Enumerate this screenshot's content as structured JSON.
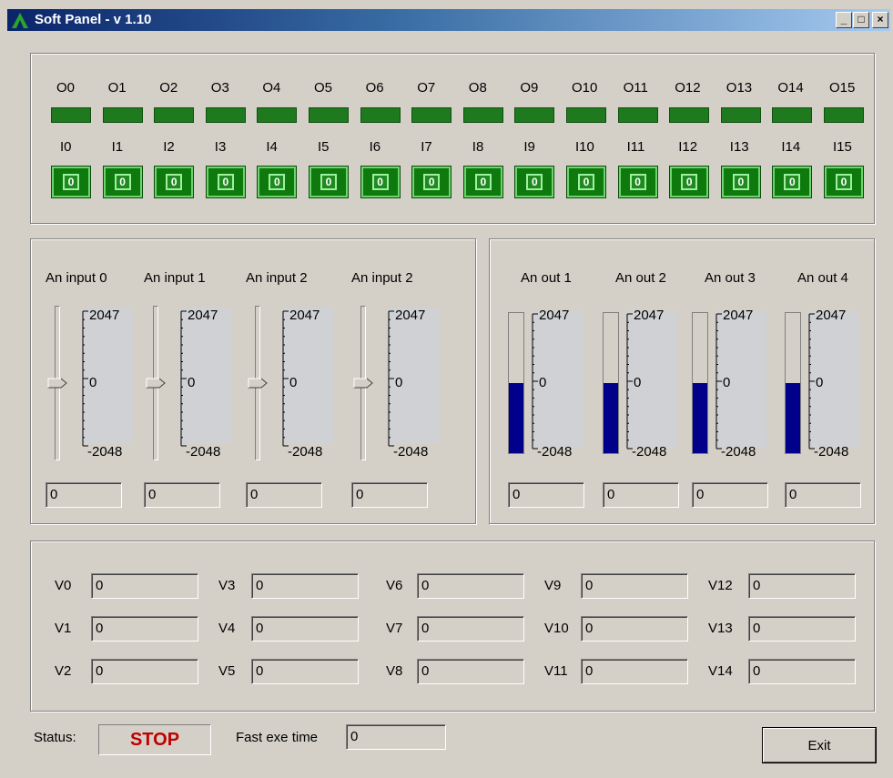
{
  "window": {
    "title": "Soft Panel - v 1.10",
    "minimize_glyph": "_",
    "maximize_glyph": "□",
    "close_glyph": "×"
  },
  "digital": {
    "outputs": [
      {
        "label": "O0",
        "state": "on"
      },
      {
        "label": "O1",
        "state": "on"
      },
      {
        "label": "O2",
        "state": "on"
      },
      {
        "label": "O3",
        "state": "on"
      },
      {
        "label": "O4",
        "state": "on"
      },
      {
        "label": "O5",
        "state": "on"
      },
      {
        "label": "O6",
        "state": "on"
      },
      {
        "label": "O7",
        "state": "on"
      },
      {
        "label": "O8",
        "state": "on"
      },
      {
        "label": "O9",
        "state": "on"
      },
      {
        "label": "O10",
        "state": "on"
      },
      {
        "label": "O11",
        "state": "on"
      },
      {
        "label": "O12",
        "state": "on"
      },
      {
        "label": "O13",
        "state": "on"
      },
      {
        "label": "O14",
        "state": "on"
      },
      {
        "label": "O15",
        "state": "on"
      }
    ],
    "inputs": [
      {
        "label": "I0",
        "value": "0"
      },
      {
        "label": "I1",
        "value": "0"
      },
      {
        "label": "I2",
        "value": "0"
      },
      {
        "label": "I3",
        "value": "0"
      },
      {
        "label": "I4",
        "value": "0"
      },
      {
        "label": "I5",
        "value": "0"
      },
      {
        "label": "I6",
        "value": "0"
      },
      {
        "label": "I7",
        "value": "0"
      },
      {
        "label": "I8",
        "value": "0"
      },
      {
        "label": "I9",
        "value": "0"
      },
      {
        "label": "I10",
        "value": "0"
      },
      {
        "label": "I11",
        "value": "0"
      },
      {
        "label": "I12",
        "value": "0"
      },
      {
        "label": "I13",
        "value": "0"
      },
      {
        "label": "I14",
        "value": "0"
      },
      {
        "label": "I15",
        "value": "0"
      }
    ]
  },
  "analog_in": [
    {
      "label": "An input 0",
      "max": "2047",
      "mid": "0",
      "min": "-2048",
      "value": "0",
      "level": 0.5
    },
    {
      "label": "An input 1",
      "max": "2047",
      "mid": "0",
      "min": "-2048",
      "value": "0",
      "level": 0.5
    },
    {
      "label": "An input 2",
      "max": "2047",
      "mid": "0",
      "min": "-2048",
      "value": "0",
      "level": 0.5
    },
    {
      "label": "An input 2",
      "max": "2047",
      "mid": "0",
      "min": "-2048",
      "value": "0",
      "level": 0.5
    }
  ],
  "analog_out": [
    {
      "label": "An out 1",
      "max": "2047",
      "mid": "0",
      "min": "-2048",
      "value": "0",
      "level": 0.5
    },
    {
      "label": "An out 2",
      "max": "2047",
      "mid": "0",
      "min": "-2048",
      "value": "0",
      "level": 0.5
    },
    {
      "label": "An out 3",
      "max": "2047",
      "mid": "0",
      "min": "-2048",
      "value": "0",
      "level": 0.5
    },
    {
      "label": "An out 4",
      "max": "2047",
      "mid": "0",
      "min": "-2048",
      "value": "0",
      "level": 0.5
    }
  ],
  "variables": [
    {
      "label": "V0",
      "value": "0"
    },
    {
      "label": "V1",
      "value": "0"
    },
    {
      "label": "V2",
      "value": "0"
    },
    {
      "label": "V3",
      "value": "0"
    },
    {
      "label": "V4",
      "value": "0"
    },
    {
      "label": "V5",
      "value": "0"
    },
    {
      "label": "V6",
      "value": "0"
    },
    {
      "label": "V7",
      "value": "0"
    },
    {
      "label": "V8",
      "value": "0"
    },
    {
      "label": "V9",
      "value": "0"
    },
    {
      "label": "V10",
      "value": "0"
    },
    {
      "label": "V11",
      "value": "0"
    },
    {
      "label": "V12",
      "value": "0"
    },
    {
      "label": "V13",
      "value": "0"
    },
    {
      "label": "V14",
      "value": "0"
    }
  ],
  "footer": {
    "status_label": "Status:",
    "status_value": "STOP",
    "fast_exe_label": "Fast exe time",
    "fast_exe_value": "0",
    "exit_label": "Exit"
  },
  "colors": {
    "led_on": "#1f7a1f",
    "status_stop": "#c00000",
    "meter_fill": "#00008b"
  }
}
